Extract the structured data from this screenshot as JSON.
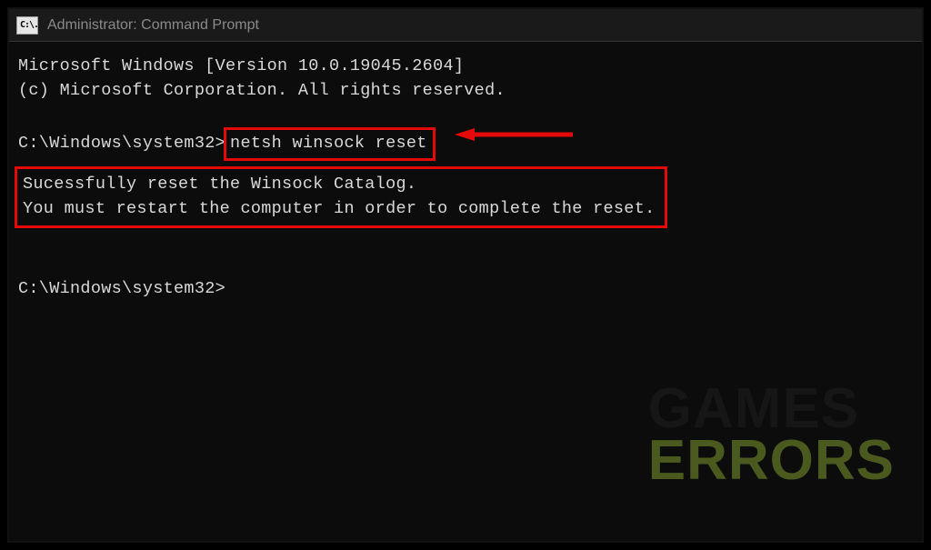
{
  "window": {
    "title": "Administrator: Command Prompt",
    "icon_label": "C:\\."
  },
  "terminal": {
    "version_line": "Microsoft Windows [Version 10.0.19045.2604]",
    "copyright_line": "(c) Microsoft Corporation. All rights reserved.",
    "prompt1_path": "C:\\Windows\\system32>",
    "command": "netsh winsock reset",
    "output_line1": "Sucessfully reset the Winsock Catalog.",
    "output_line2": "You must restart the computer in order to complete the reset.",
    "prompt2_path": "C:\\Windows\\system32>"
  },
  "annotation": {
    "highlight_color": "#e40a0a"
  },
  "watermark": {
    "line1": "GAMES",
    "line2": "ERRORS"
  }
}
